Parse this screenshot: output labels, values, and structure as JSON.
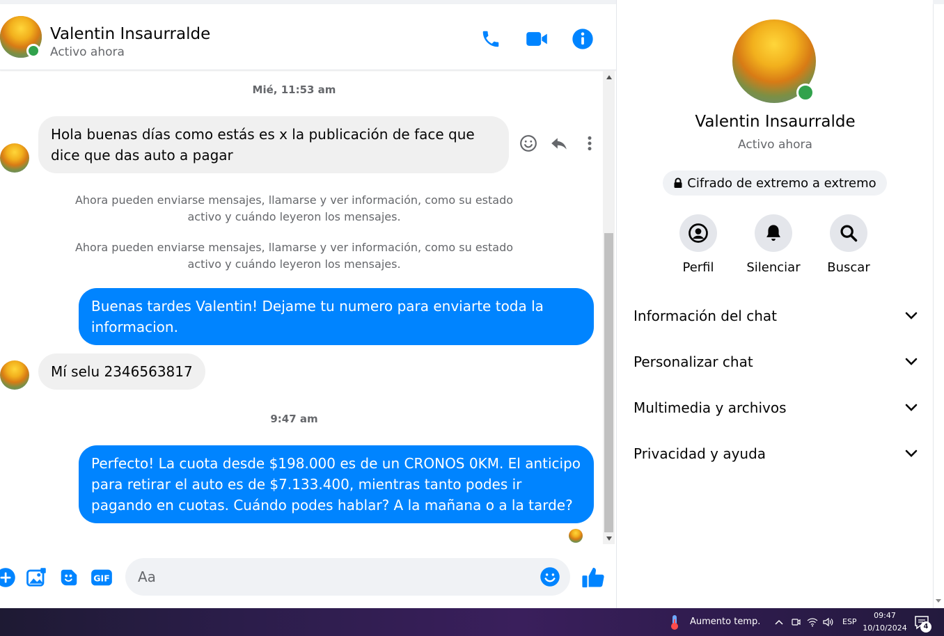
{
  "colors": {
    "accent": "#0084ff",
    "incoming_bubble": "#f0f0f0",
    "online": "#31a24c",
    "secondary_text": "#65676b"
  },
  "header": {
    "name": "Valentin Insaurralde",
    "status": "Activo ahora",
    "icons": [
      "phone-icon",
      "video-camera-icon",
      "info-icon"
    ]
  },
  "messages": {
    "timestamp_1": "Mié, 11:53 am",
    "incoming_1": "Hola buenas días como estás es x la publicación de face que dice que das auto a pagar",
    "system_note_1": "Ahora pueden enviarse mensajes, llamarse y ver información, como su estado activo y cuándo leyeron los mensajes.",
    "system_note_2": "Ahora pueden enviarse mensajes, llamarse y ver información, como su estado activo y cuándo leyeron los mensajes.",
    "outgoing_1": "Buenas tardes Valentin! Dejame tu numero para enviarte toda la informacion.",
    "incoming_2": "Mí selu 2346563817",
    "timestamp_2": "9:47 am",
    "outgoing_2": "Perfecto! La cuota desde $198.000 es de un CRONOS 0KM. El anticipo para retirar el auto es de $7.133.400, mientras tanto podes ir pagando en cuotas. Cuándo podes hablar? A la mañana o a la tarde?",
    "hover_actions": [
      "smiley-icon",
      "reply-icon",
      "more-icon"
    ]
  },
  "composer": {
    "placeholder": "Aa",
    "icons": [
      "plus-icon",
      "image-icon",
      "sticker-icon",
      "gif-icon",
      "emoji-icon",
      "like-icon"
    ],
    "gif_label": "GIF"
  },
  "details": {
    "name": "Valentin Insaurralde",
    "status": "Activo ahora",
    "encryption": "Cifrado de extremo a extremo",
    "actions": [
      {
        "label": "Perfil",
        "icon": "profile-icon"
      },
      {
        "label": "Silenciar",
        "icon": "bell-icon"
      },
      {
        "label": "Buscar",
        "icon": "search-icon"
      }
    ],
    "sections": [
      {
        "label": "Información del chat"
      },
      {
        "label": "Personalizar chat"
      },
      {
        "label": "Multimedia y archivos"
      },
      {
        "label": "Privacidad y ayuda"
      }
    ]
  },
  "taskbar": {
    "weather_label": "Aumento temp.",
    "language": "ESP",
    "time": "09:47",
    "date": "10/10/2024",
    "notification_count": "4"
  }
}
